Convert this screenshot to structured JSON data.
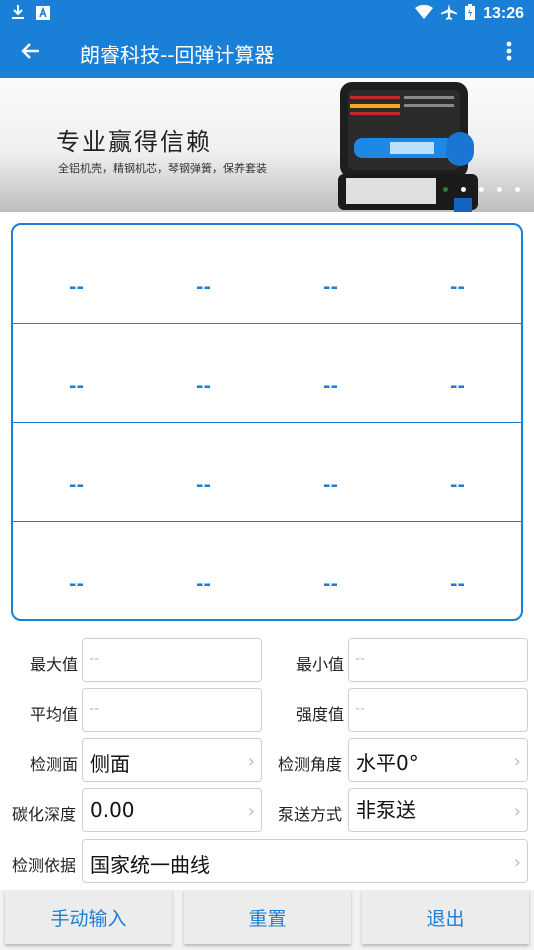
{
  "status_bar": {
    "time": "13:26",
    "icons": [
      "download-icon",
      "a-icon",
      "wifi-icon",
      "airplane-icon",
      "battery-icon"
    ]
  },
  "app_bar": {
    "title": "朗睿科技--回弹计算器",
    "back_icon": "arrow-left-icon",
    "menu_icon": "more-vert-icon"
  },
  "banner": {
    "title": "专业赢得信赖",
    "subtitle": "全铝机壳，精钢机芯，琴钢弹簧，保养套装",
    "slide_count": 5,
    "active_slide": 1
  },
  "grid": {
    "rows": [
      [
        "--",
        "--",
        "--",
        "--"
      ],
      [
        "--",
        "--",
        "--",
        "--"
      ],
      [
        "--",
        "--",
        "--",
        "--"
      ],
      [
        "--",
        "--",
        "--",
        "--"
      ]
    ]
  },
  "form": {
    "max_label": "最大值",
    "max_value": "--",
    "min_label": "最小值",
    "min_value": "--",
    "avg_label": "平均值",
    "avg_value": "--",
    "strength_label": "强度值",
    "strength_value": "--",
    "surface_label": "检测面",
    "surface_value": "侧面",
    "angle_label": "检测角度",
    "angle_value": "水平0°",
    "carbon_label": "碳化深度",
    "carbon_value": "0.00",
    "pump_label": "泵送方式",
    "pump_value": "非泵送",
    "basis_label": "检测依据",
    "basis_value": "国家统一曲线"
  },
  "buttons": {
    "manual": "手动输入",
    "reset": "重置",
    "exit": "退出"
  },
  "colors": {
    "primary": "#1a7fd6"
  }
}
